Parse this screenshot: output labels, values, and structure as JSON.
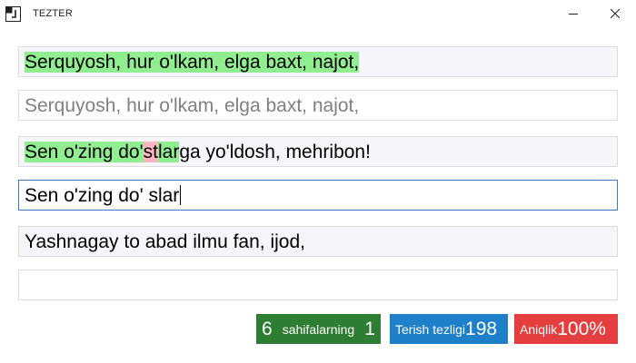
{
  "window": {
    "title": "TEZTER",
    "icon": "app-icon",
    "minimize_icon": "minimize-icon",
    "close_icon": "close-icon"
  },
  "lines": [
    {
      "sample_segments": [
        {
          "text": "Serquyosh, hur o'lkam, elga baxt, najot,",
          "state": "correct"
        }
      ],
      "typed": "Serquyosh, hur o'lkam, elga baxt, najot,"
    },
    {
      "sample_segments": [
        {
          "text": "Sen o'zing do'",
          "state": "correct"
        },
        {
          "text": "st",
          "state": "error"
        },
        {
          "text": "lar",
          "state": "correct"
        },
        {
          "text": "ga yo'ldosh, mehribon!",
          "state": "pending"
        }
      ],
      "typed": "Sen o'zing do' slar"
    },
    {
      "sample_segments": [
        {
          "text": "Yashnagay to abad ilmu fan, ijod,",
          "state": "pending"
        }
      ],
      "typed": ""
    }
  ],
  "stats": {
    "pages_value": "6",
    "pages_label": "sahifalarning",
    "pages_current": "1",
    "speed_label": "Terish tezligi",
    "speed_value": "198",
    "accuracy_label": "Aniqlik",
    "accuracy_value": "100%"
  },
  "colors": {
    "correct_highlight": "#90ee90",
    "error_highlight": "#ffb6c1",
    "pages_badge": "#2e7d32",
    "speed_badge": "#1e80c8",
    "accuracy_badge": "#e53e3e",
    "active_input_border": "#3c78c8"
  }
}
